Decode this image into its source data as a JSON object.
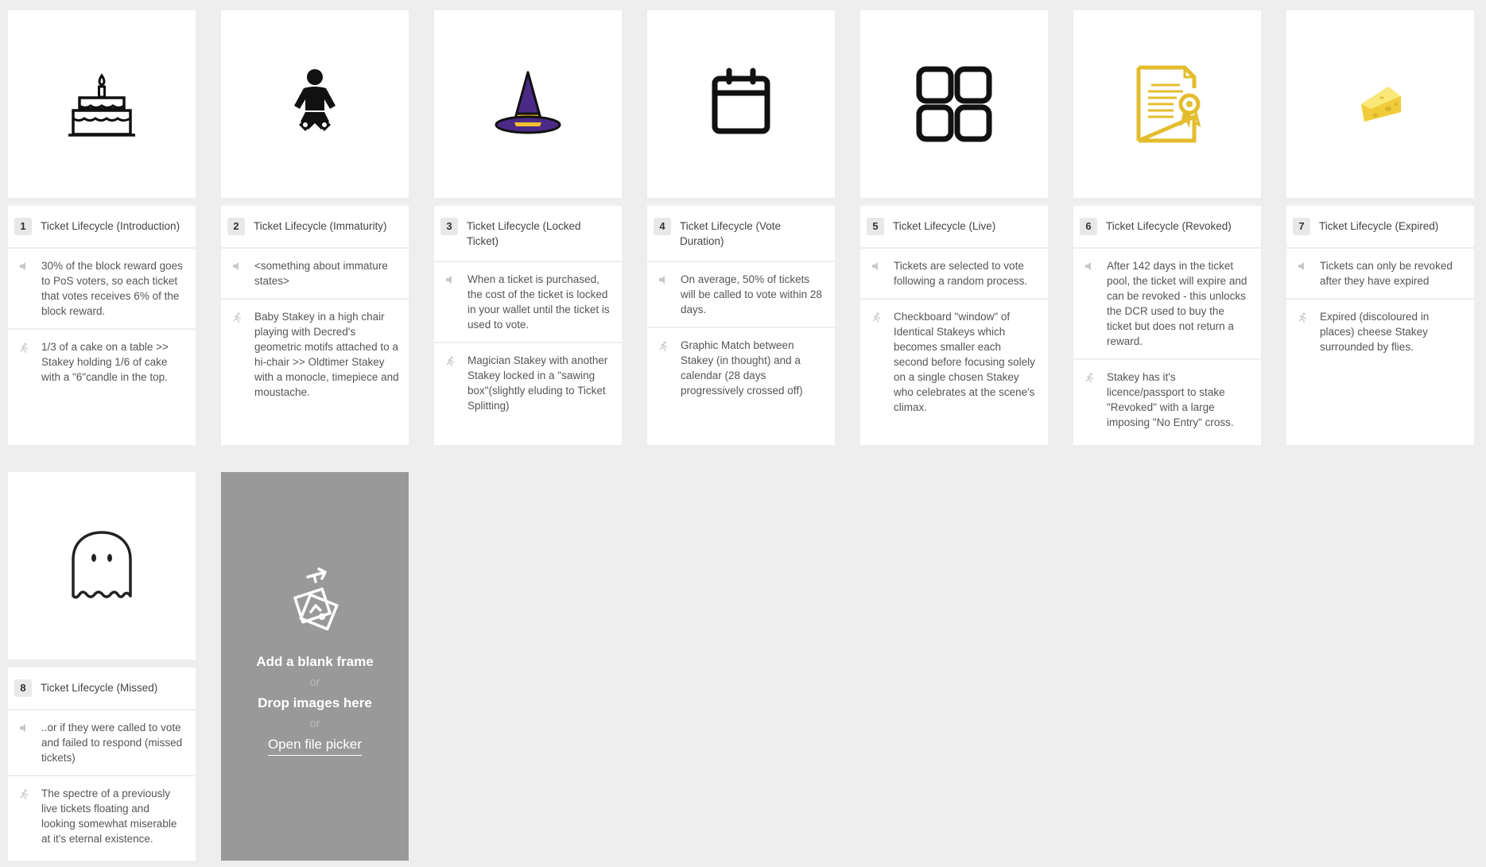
{
  "frames": [
    {
      "number": "1",
      "title": "Ticket Lifecycle (Introduction)",
      "audio": "30% of the block reward goes to PoS voters, so each ticket that votes receives 6% of the block reward.",
      "visual": "1/3 of a cake on a table >> Stakey holding 1/6 of cake with a \"6\"candle in the top.",
      "image_icon": "birthday-cake-icon"
    },
    {
      "number": "2",
      "title": "Ticket Lifecycle (Immaturity)",
      "audio": "<something about immature states>",
      "visual": "Baby Stakey in a high chair playing with Decred's geometric motifs attached to a hi-chair >> Oldtimer Stakey with a monocle, timepiece and moustache.",
      "image_icon": "baby-icon"
    },
    {
      "number": "3",
      "title": "Ticket Lifecycle (Locked Ticket)",
      "audio": "When a ticket is purchased, the cost of the ticket is locked in your wallet until the ticket is used to vote.",
      "visual": "Magician Stakey with another Stakey locked in a \"sawing box\"(slightly eluding to Ticket Splitting)",
      "image_icon": "wizard-hat-icon"
    },
    {
      "number": "4",
      "title": "Ticket Lifecycle (Vote Duration)",
      "audio": "On average, 50% of tickets will be called to vote within 28 days.",
      "visual": "Graphic Match between Stakey (in thought) and a calendar (28 days progressively crossed off)",
      "image_icon": "calendar-icon"
    },
    {
      "number": "5",
      "title": "Ticket Lifecycle (Live)",
      "audio": "Tickets are selected to vote following a random process.",
      "visual": "Checkboard \"window\" of Identical Stakeys which becomes smaller each second before focusing solely on a single chosen Stakey who celebrates at the scene's climax.",
      "image_icon": "window-grid-icon"
    },
    {
      "number": "6",
      "title": "Ticket Lifecycle (Revoked)",
      "audio": "After 142 days in the ticket pool, the ticket will expire and can be revoked - this unlocks the DCR used to buy the ticket but does not return a reward.",
      "visual": "Stakey has it's licence/passport to stake \"Revoked\" with a large imposing \"No Entry\" cross.",
      "image_icon": "certificate-icon"
    },
    {
      "number": "7",
      "title": "Ticket Lifecycle (Expired)",
      "audio": "Tickets can  only  be revoked after they have expired",
      "visual": "Expired (discoloured in places) cheese Stakey surrounded by flies.",
      "image_icon": "cheese-icon"
    },
    {
      "number": "8",
      "title": "Ticket Lifecycle (Missed)",
      "audio": "..or if they were called to vote and failed to respond (missed tickets)",
      "visual": "The spectre of a previously live tickets floating and looking somewhat miserable at it's eternal existence.",
      "image_icon": "ghost-icon"
    }
  ],
  "row_icons": {
    "audio": "speaker-icon",
    "visual": "running-figure-icon"
  },
  "dropzone": {
    "add_blank": "Add a blank frame",
    "or1": "or",
    "drop_images": "Drop images here",
    "or2": "or",
    "open_picker": "Open file picker",
    "icon": "upload-images-icon"
  },
  "colors": {
    "page_bg": "#eeeeee",
    "card_bg": "#ffffff",
    "dropzone_bg": "#999999",
    "wizard_purple": "#4b2a87",
    "wizard_yellow": "#f2c12e",
    "certificate_gold": "#e3bd2e",
    "cheese_yellow": "#f5d84e"
  }
}
